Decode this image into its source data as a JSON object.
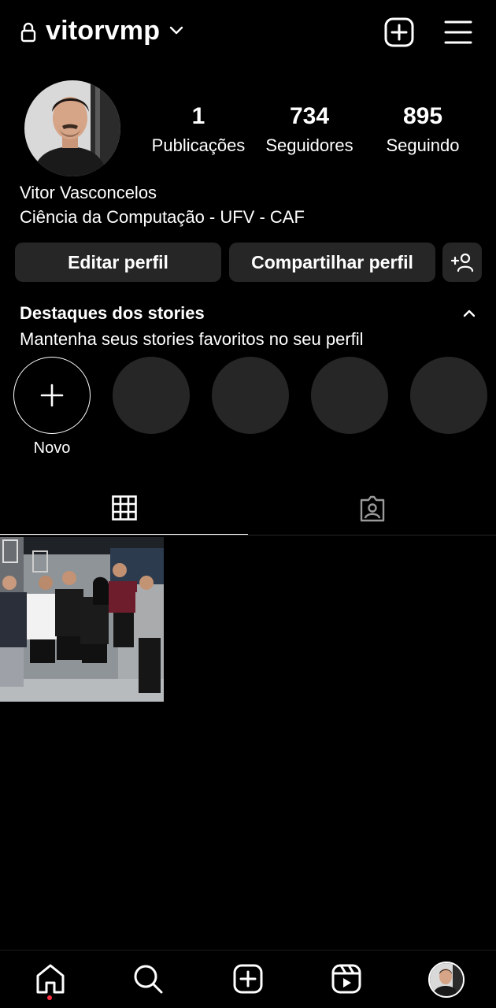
{
  "header": {
    "username": "vitorvmp",
    "icons": [
      "lock-icon",
      "chevron-down-icon",
      "new-post-icon",
      "menu-icon"
    ]
  },
  "profile": {
    "stats": {
      "posts": {
        "value": "1",
        "label": "Publicações"
      },
      "followers": {
        "value": "734",
        "label": "Seguidores"
      },
      "following": {
        "value": "895",
        "label": "Seguindo"
      }
    },
    "full_name": "Vitor Vasconcelos",
    "bio": "Ciência da Computação - UFV - CAF"
  },
  "actions": {
    "edit_profile": "Editar perfil",
    "share_profile": "Compartilhar perfil"
  },
  "highlights": {
    "title": "Destaques dos stories",
    "subtitle": "Mantenha seus stories favoritos no seu perfil",
    "new_label": "Novo"
  },
  "colors": {
    "background": "#000000",
    "surface": "#262626",
    "text": "#ffffff",
    "notification": "#ff3040"
  }
}
